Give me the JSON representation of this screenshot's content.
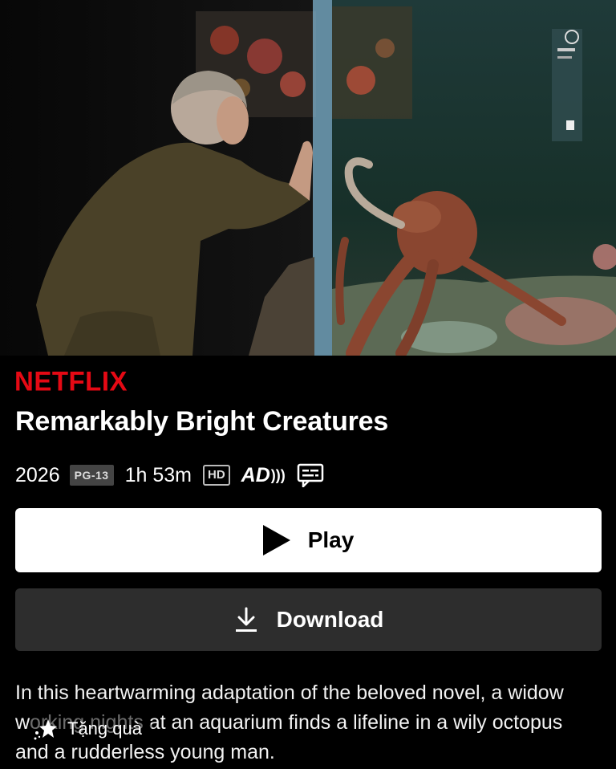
{
  "brand": "NETFLIX",
  "colors": {
    "brand": "#e50914",
    "background": "#000000",
    "play_bg": "#ffffff",
    "download_bg": "#2d2d2d"
  },
  "title": "Remarkably Bright Creatures",
  "meta": {
    "year": "2026",
    "rating": "PG-13",
    "runtime": "1h 53m",
    "quality": "HD",
    "audio_description": "AD",
    "audio_description_waves": ")))",
    "subtitles_icon": "subtitles-icon"
  },
  "actions": {
    "play_label": "Play",
    "play_icon": "play-icon",
    "download_label": "Download",
    "download_icon": "download-icon"
  },
  "synopsis": "In this heartwarming adaptation of the beloved novel, a widow working nights at an aquarium finds a lifeline in a wily octopus and a rudderless young man.",
  "overlay": {
    "gift_label": "Tặng quà",
    "gift_icon": "sparkle-icon"
  }
}
